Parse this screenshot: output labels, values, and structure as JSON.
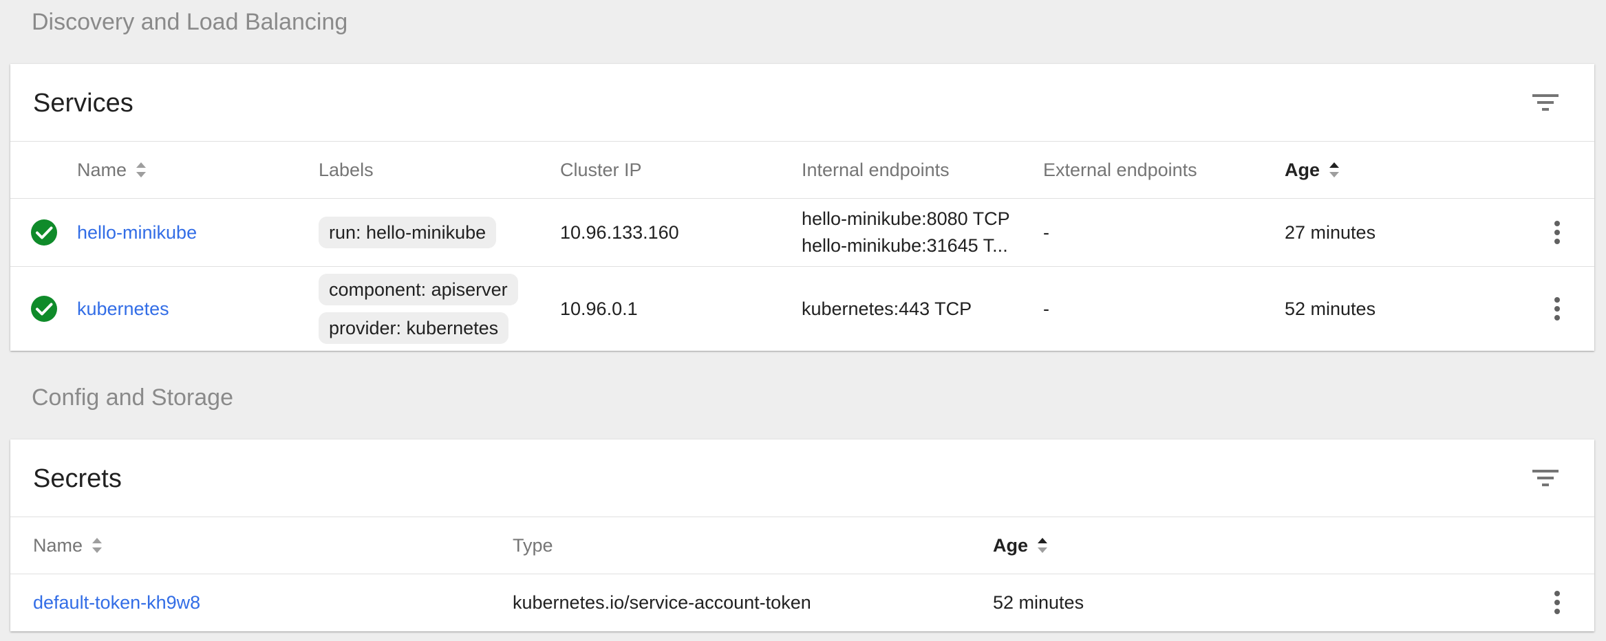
{
  "sections": {
    "discovery_title": "Discovery and Load Balancing",
    "config_title": "Config and Storage"
  },
  "services": {
    "title": "Services",
    "columns": {
      "name": "Name",
      "labels": "Labels",
      "cluster_ip": "Cluster IP",
      "internal": "Internal endpoints",
      "external": "External endpoints",
      "age": "Age"
    },
    "rows": [
      {
        "name": "hello-minikube",
        "labels": [
          "run: hello-minikube"
        ],
        "cluster_ip": "10.96.133.160",
        "internal": [
          "hello-minikube:8080 TCP",
          "hello-minikube:31645 T..."
        ],
        "external": "-",
        "age": "27 minutes",
        "status": "ok"
      },
      {
        "name": "kubernetes",
        "labels": [
          "component: apiserver",
          "provider: kubernetes"
        ],
        "cluster_ip": "10.96.0.1",
        "internal": [
          "kubernetes:443 TCP"
        ],
        "external": "-",
        "age": "52 minutes",
        "status": "ok"
      }
    ]
  },
  "secrets": {
    "title": "Secrets",
    "columns": {
      "name": "Name",
      "type": "Type",
      "age": "Age"
    },
    "rows": [
      {
        "name": "default-token-kh9w8",
        "type": "kubernetes.io/service-account-token",
        "age": "52 minutes"
      }
    ]
  },
  "icons": {
    "filter": "filter-icon",
    "status_ok": "check-circle-icon",
    "more": "more-vert-icon",
    "sort": "sort-icon"
  },
  "colors": {
    "link": "#326de6",
    "status_ok": "#0f8b2a"
  }
}
